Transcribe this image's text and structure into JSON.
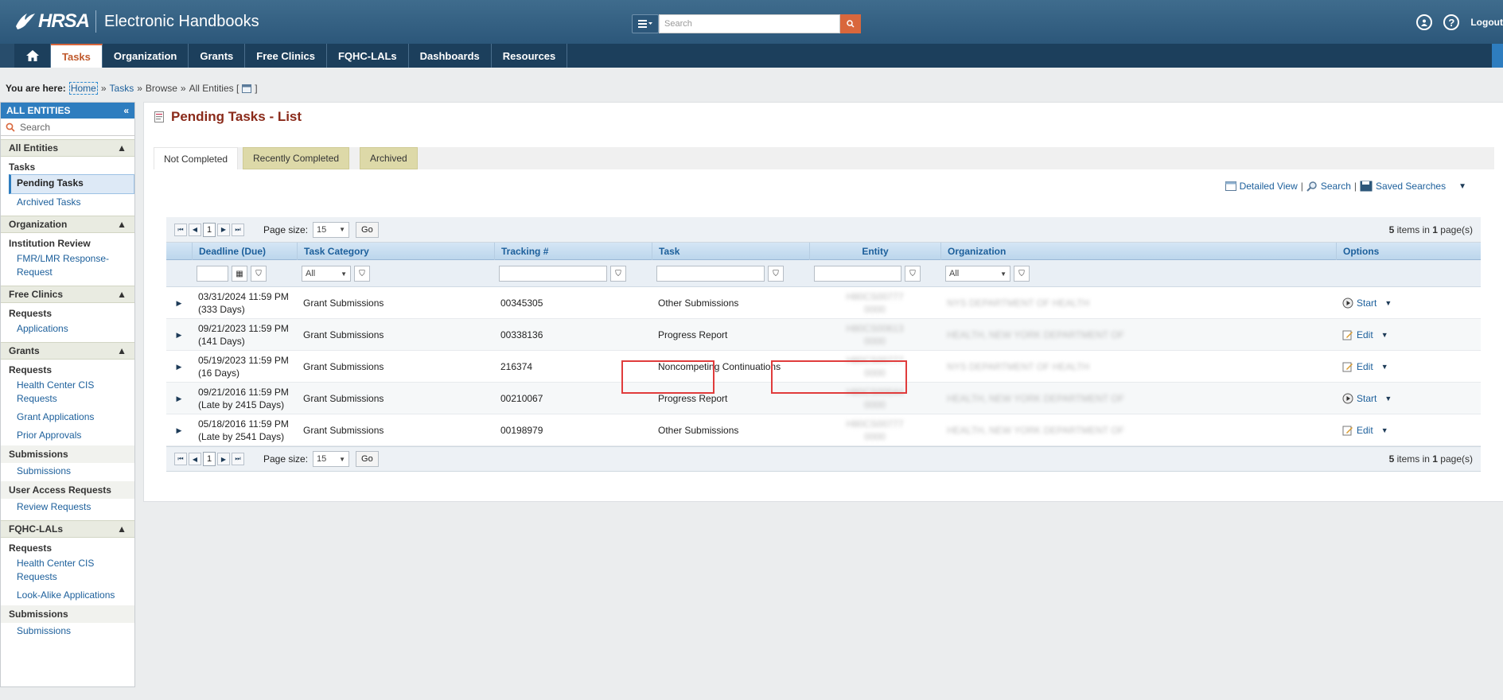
{
  "header": {
    "logo_text": "HRSA",
    "app_title": "Electronic Handbooks",
    "search_placeholder": "Search",
    "logout_label": "Logout"
  },
  "nav": {
    "items": [
      "Tasks",
      "Organization",
      "Grants",
      "Free Clinics",
      "FQHC-LALs",
      "Dashboards",
      "Resources"
    ],
    "active": "Tasks"
  },
  "breadcrumb": {
    "prefix": "You are here:",
    "home": "Home",
    "sep": "»",
    "tasks": "Tasks",
    "browse": "Browse",
    "entity": "All Entities [",
    "entity_close": "]"
  },
  "sidebar": {
    "title": "ALL ENTITIES",
    "search_placeholder": "Search",
    "sections": [
      {
        "title": "All Entities",
        "groups": [
          {
            "label": "Tasks",
            "links": [
              "Pending Tasks",
              "Archived Tasks"
            ]
          }
        ]
      },
      {
        "title": "Organization",
        "groups": [
          {
            "label": "Institution Review",
            "links": [
              "FMR/LMR Response-Request"
            ]
          }
        ]
      },
      {
        "title": "Free Clinics",
        "groups": [
          {
            "label": "Requests",
            "links": [
              "Applications"
            ]
          }
        ]
      },
      {
        "title": "Grants",
        "groups": [
          {
            "label": "Requests",
            "links": [
              "Health Center CIS Requests",
              "Grant Applications",
              "Prior Approvals"
            ]
          },
          {
            "label": "Submissions",
            "links": [
              "Submissions"
            ]
          },
          {
            "label": "User Access Requests",
            "links": [
              "Review Requests"
            ]
          }
        ]
      },
      {
        "title": "FQHC-LALs",
        "groups": [
          {
            "label": "Requests",
            "links": [
              "Health Center CIS Requests",
              "Look-Alike Applications"
            ]
          },
          {
            "label": "Submissions",
            "links": [
              "Submissions"
            ]
          }
        ]
      }
    ]
  },
  "main": {
    "title": "Pending Tasks - List",
    "tabs": [
      "Not Completed",
      "Recently Completed",
      "Archived"
    ],
    "view_links": {
      "detailed": "Detailed View",
      "search": "Search",
      "saved": "Saved Searches",
      "sep": "|"
    },
    "pager": {
      "page": "1",
      "page_size_label": "Page size:",
      "page_size": "15",
      "go": "Go",
      "info_count": "5",
      "info_mid": " items in ",
      "info_pages": "1",
      "info_tail": " page(s)"
    },
    "columns": [
      "Deadline (Due)",
      "Task Category",
      "Tracking #",
      "Task",
      "Entity",
      "Organization",
      "Options"
    ],
    "filters": {
      "category": "All",
      "organization": "All"
    },
    "rows": [
      {
        "deadline": "03/31/2024 11:59 PM",
        "days": "(333 Days)",
        "category": "Grant Submissions",
        "tracking": "00345305",
        "task": "Other Submissions",
        "entity_a": "H80CS00777",
        "entity_b": "0000",
        "org": "NYS DEPARTMENT OF HEALTH",
        "option": "Start"
      },
      {
        "deadline": "09/21/2023 11:59 PM",
        "days": "(141 Days)",
        "category": "Grant Submissions",
        "tracking": "00338136",
        "task": "Progress Report",
        "entity_a": "H80CS00613",
        "entity_b": "0000",
        "org": "HEALTH, NEW YORK DEPARTMENT OF",
        "option": "Edit"
      },
      {
        "deadline": "05/19/2023 11:59 PM",
        "days": "(16 Days)",
        "category": "Grant Submissions",
        "tracking": "216374",
        "task": "Noncompeting Continuations",
        "entity_a": "H80CS00777",
        "entity_b": "0000",
        "org": "NYS DEPARTMENT OF HEALTH",
        "option": "Edit"
      },
      {
        "deadline": "09/21/2016 11:59 PM",
        "days": "(Late by 2415 Days)",
        "category": "Grant Submissions",
        "tracking": "00210067",
        "task": "Progress Report",
        "entity_a": "H80CS00044",
        "entity_b": "0000",
        "org": "HEALTH, NEW YORK DEPARTMENT OF",
        "option": "Start"
      },
      {
        "deadline": "05/18/2016 11:59 PM",
        "days": "(Late by 2541 Days)",
        "category": "Grant Submissions",
        "tracking": "00198979",
        "task": "Other Submissions",
        "entity_a": "H80CS00777",
        "entity_b": "0000",
        "org": "HEALTH, NEW YORK DEPARTMENT OF",
        "option": "Edit"
      }
    ]
  },
  "colors": {
    "header": "#2c577a",
    "nav": "#1c3f5c",
    "accent": "#d9673c",
    "link": "#1c5f9b",
    "highlight": "#e03c3c"
  }
}
